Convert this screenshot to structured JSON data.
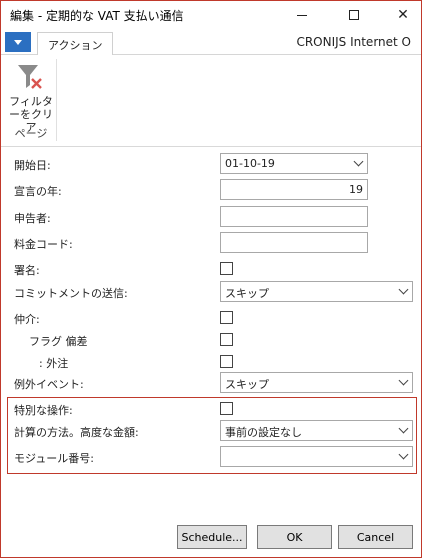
{
  "window": {
    "title": "編集 - 定期的な VAT 支払い通信",
    "controls": {
      "minimize": "—",
      "maximize": "☐",
      "close": "✕"
    }
  },
  "ribbon": {
    "menu_icon": "dropdown-triangle-icon",
    "active_tab": "アクション",
    "company": "CRONIJS Internet O",
    "clear_filter_label": "フィルターをクリア",
    "clear_filter_line1": "フィルタ",
    "clear_filter_line2": "ーをクリア",
    "group_label": "ページ"
  },
  "form": {
    "start_date": {
      "label": "開始日:",
      "value": "01-10-19"
    },
    "declaration_year": {
      "label": "宣言の年:",
      "value": "19"
    },
    "declarant": {
      "label": "申告者:",
      "value": ""
    },
    "fee_code": {
      "label": "料金コード:",
      "value": ""
    },
    "signature": {
      "label": "署名:",
      "checked": false
    },
    "commitment_send": {
      "label": "コミットメントの送信:",
      "value": "スキップ"
    },
    "intermediary": {
      "label": "仲介:",
      "checked": false
    },
    "flag_deviation": {
      "label": "フラグ 偏差",
      "checked": false
    },
    "outsourcing": {
      "label": ": 外注",
      "checked": false
    },
    "exception_event": {
      "label": "例外イベント:",
      "value": "スキップ"
    },
    "special_operation": {
      "label": "特別な操作:",
      "checked": false
    },
    "calc_method": {
      "label": "計算の方法。高度な金額:",
      "value": "事前の設定なし"
    },
    "module_number": {
      "label": "モジュール番号:",
      "value": ""
    }
  },
  "footer": {
    "schedule": "Schedule...",
    "ok": "OK",
    "cancel": "Cancel"
  },
  "colors": {
    "accent": "#2b6fc1",
    "highlight_border": "#c0392b"
  }
}
